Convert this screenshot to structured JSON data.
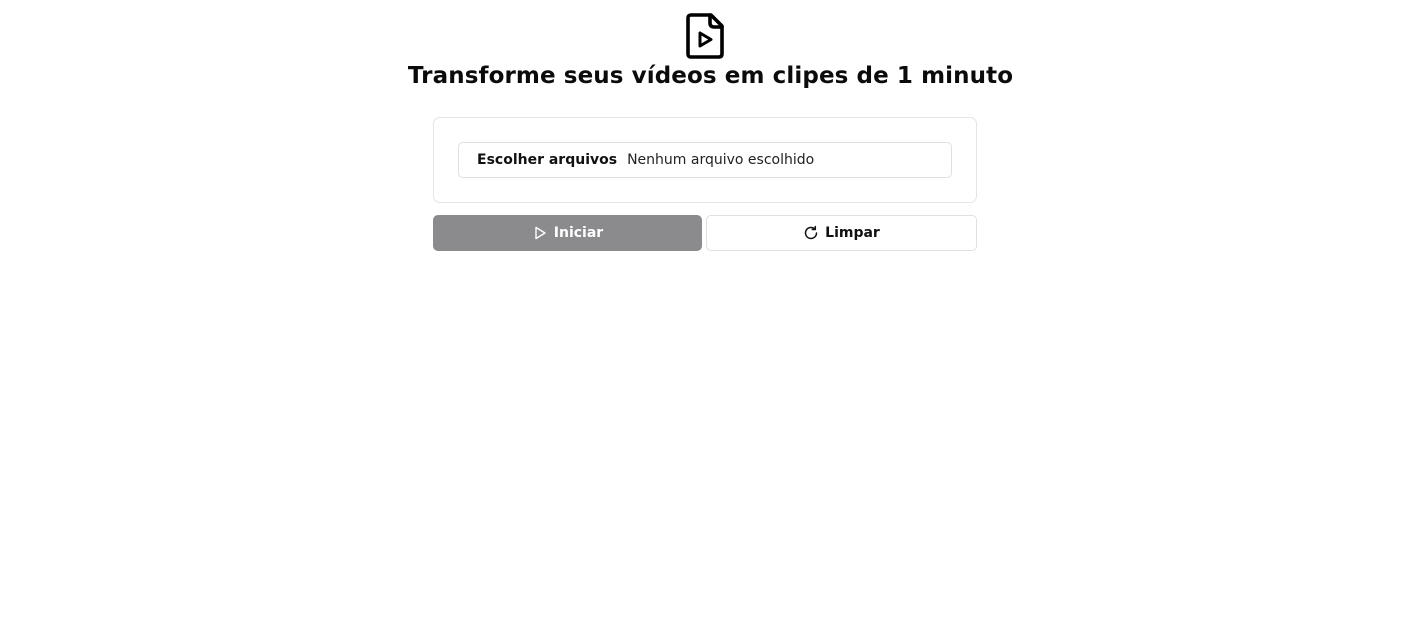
{
  "header": {
    "icon": "file-video-icon",
    "title": "Transforme seus vídeos em clipes de 1 minuto"
  },
  "upload": {
    "choose_label": "Escolher arquivos",
    "status_text": "Nenhum arquivo escolhido"
  },
  "actions": {
    "start_label": "Iniciar",
    "start_icon": "play-icon",
    "start_color": "#8b8b8d",
    "clear_label": "Limpar",
    "clear_icon": "refresh-icon"
  }
}
